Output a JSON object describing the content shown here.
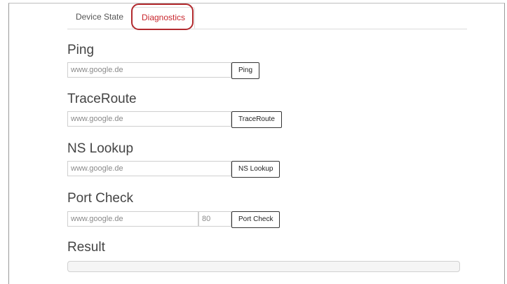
{
  "tabs": {
    "device_state": "Device State",
    "diagnostics": "Diagnostics"
  },
  "ping": {
    "title": "Ping",
    "placeholder": "www.google.de",
    "button": "Ping"
  },
  "traceroute": {
    "title": "TraceRoute",
    "placeholder": "www.google.de",
    "button": "TraceRoute"
  },
  "nslookup": {
    "title": "NS Lookup",
    "placeholder": "www.google.de",
    "button": "NS Lookup"
  },
  "portcheck": {
    "title": "Port Check",
    "placeholder": "www.google.de",
    "port_placeholder": "80",
    "button": "Port Check"
  },
  "result": {
    "title": "Result"
  },
  "colors": {
    "active_tab": "#c8252c",
    "highlight": "#b22a2e"
  }
}
